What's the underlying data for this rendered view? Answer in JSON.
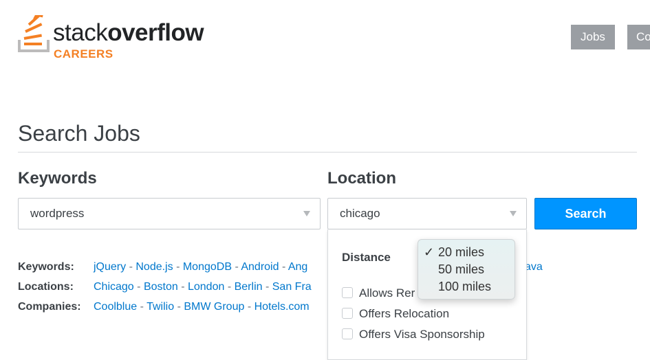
{
  "brand": {
    "name_light": "stack",
    "name_bold": "overflow",
    "sub": "CAREERS",
    "colors": {
      "orange": "#f48024",
      "gray": "#bcbbbb"
    }
  },
  "nav": [
    {
      "label": "Jobs"
    },
    {
      "label": "Co"
    }
  ],
  "page_title": "Search Jobs",
  "keywords": {
    "label": "Keywords",
    "value": "wordpress"
  },
  "location": {
    "label": "Location",
    "value": "chicago"
  },
  "search_button": "Search",
  "accent": "#0095ff",
  "filters": {
    "distance_label": "Distance",
    "distance_options": [
      {
        "label": "20 miles",
        "selected": true
      },
      {
        "label": "50 miles",
        "selected": false
      },
      {
        "label": "100 miles",
        "selected": false
      }
    ],
    "checkboxes": [
      {
        "label": "Allows Rer",
        "checked": false
      },
      {
        "label": "Offers Relocation",
        "checked": false
      },
      {
        "label": "Offers Visa Sponsorship",
        "checked": false
      }
    ]
  },
  "quick_links": {
    "separator": "-",
    "keywords": {
      "label": "Keywords:",
      "items": [
        "jQuery",
        "Node.js",
        "MongoDB",
        "Android",
        "Ang"
      ],
      "tail": "ava"
    },
    "locations": {
      "label": "Locations:",
      "items": [
        "Chicago",
        "Boston",
        "London",
        "Berlin",
        "San Fra"
      ]
    },
    "companies": {
      "label": "Companies:",
      "items": [
        "Coolblue",
        "Twilio",
        "BMW Group",
        "Hotels.com"
      ]
    }
  }
}
